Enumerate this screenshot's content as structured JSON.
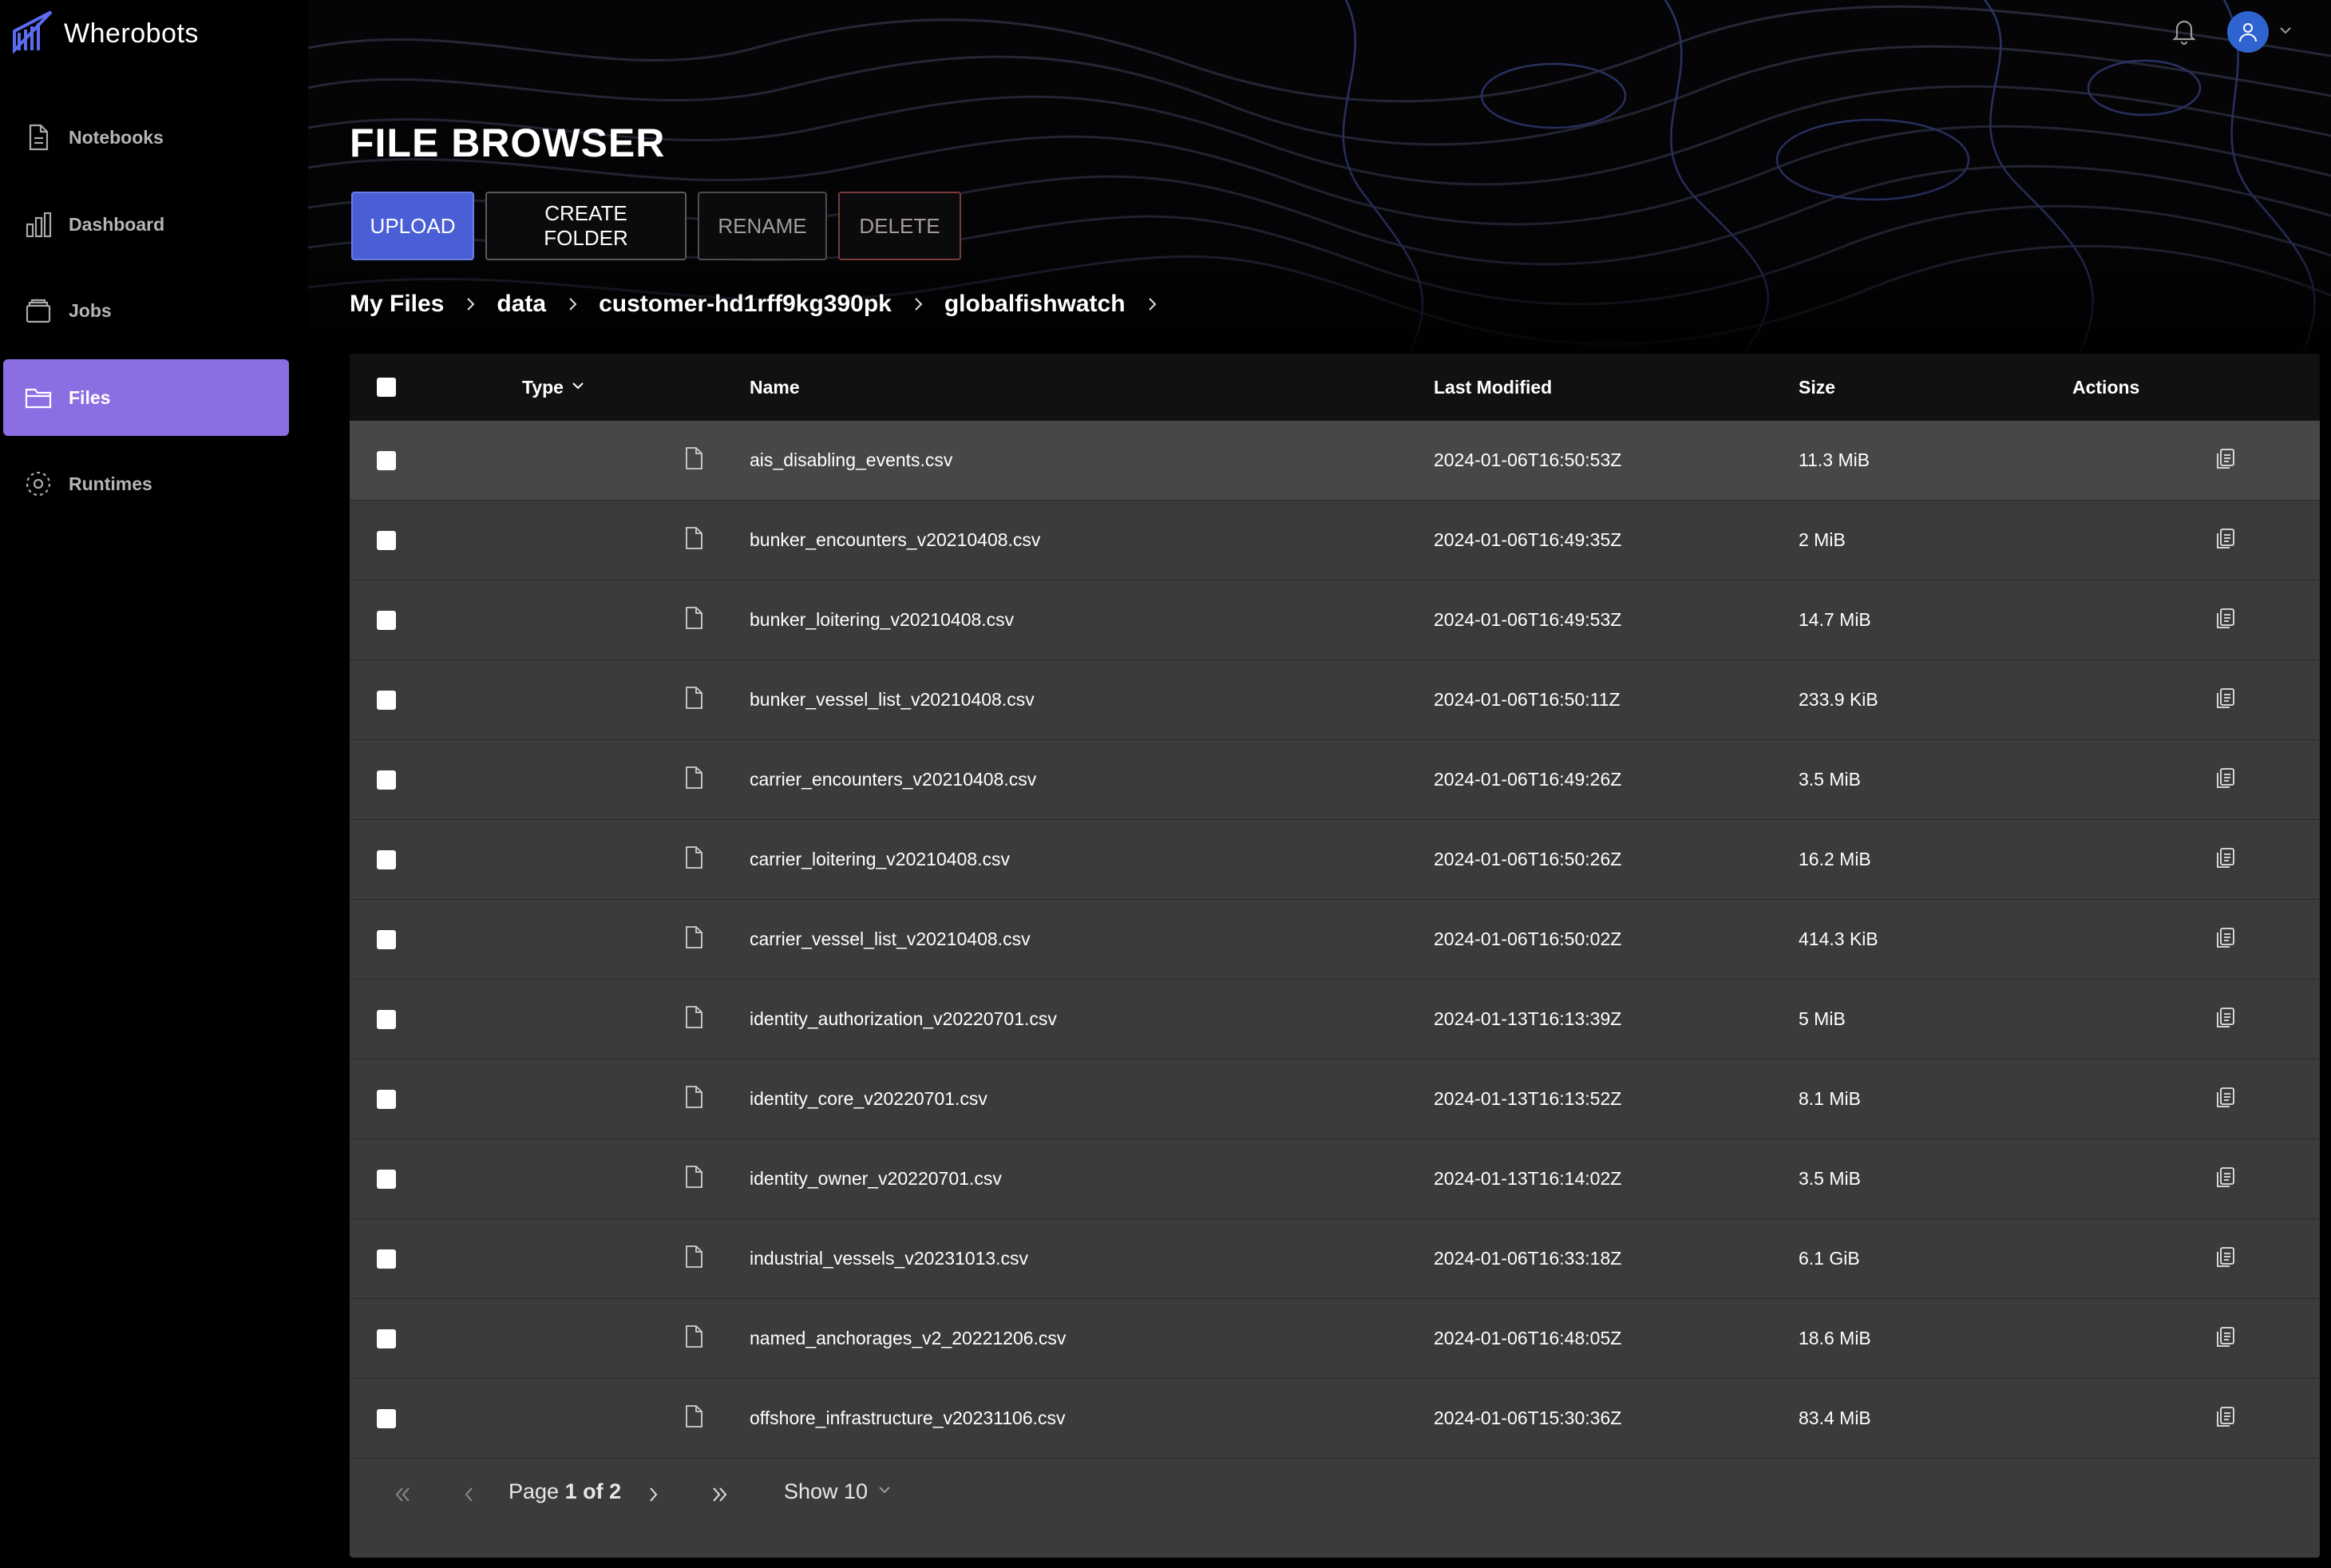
{
  "brand": {
    "name": "Wherobots"
  },
  "nav": [
    {
      "label": "Notebooks",
      "icon": "document-icon",
      "active": false
    },
    {
      "label": "Dashboard",
      "icon": "bar-chart-icon",
      "active": false
    },
    {
      "label": "Jobs",
      "icon": "jobs-box-icon",
      "active": false
    },
    {
      "label": "Files",
      "icon": "folder-icon",
      "active": true
    },
    {
      "label": "Runtimes",
      "icon": "runtimes-icon",
      "active": false
    }
  ],
  "header": {
    "title": "FILE BROWSER"
  },
  "toolbar": {
    "upload": "UPLOAD",
    "create_folder": "CREATE FOLDER",
    "rename": "RENAME",
    "delete": "DELETE"
  },
  "breadcrumb": [
    "My Files",
    "data",
    "customer-hd1rff9kg390pk",
    "globalfishwatch"
  ],
  "table": {
    "columns": {
      "type": "Type",
      "name": "Name",
      "modified": "Last Modified",
      "size": "Size",
      "actions": "Actions"
    },
    "rows": [
      {
        "name": "ais_disabling_events.csv",
        "modified": "2024-01-06T16:50:53Z",
        "size": "11.3 MiB"
      },
      {
        "name": "bunker_encounters_v20210408.csv",
        "modified": "2024-01-06T16:49:35Z",
        "size": "2 MiB"
      },
      {
        "name": "bunker_loitering_v20210408.csv",
        "modified": "2024-01-06T16:49:53Z",
        "size": "14.7 MiB"
      },
      {
        "name": "bunker_vessel_list_v20210408.csv",
        "modified": "2024-01-06T16:50:11Z",
        "size": "233.9 KiB"
      },
      {
        "name": "carrier_encounters_v20210408.csv",
        "modified": "2024-01-06T16:49:26Z",
        "size": "3.5 MiB"
      },
      {
        "name": "carrier_loitering_v20210408.csv",
        "modified": "2024-01-06T16:50:26Z",
        "size": "16.2 MiB"
      },
      {
        "name": "carrier_vessel_list_v20210408.csv",
        "modified": "2024-01-06T16:50:02Z",
        "size": "414.3 KiB"
      },
      {
        "name": "identity_authorization_v20220701.csv",
        "modified": "2024-01-13T16:13:39Z",
        "size": "5 MiB"
      },
      {
        "name": "identity_core_v20220701.csv",
        "modified": "2024-01-13T16:13:52Z",
        "size": "8.1 MiB"
      },
      {
        "name": "identity_owner_v20220701.csv",
        "modified": "2024-01-13T16:14:02Z",
        "size": "3.5 MiB"
      },
      {
        "name": "industrial_vessels_v20231013.csv",
        "modified": "2024-01-06T16:33:18Z",
        "size": "6.1 GiB"
      },
      {
        "name": "named_anchorages_v2_20221206.csv",
        "modified": "2024-01-06T16:48:05Z",
        "size": "18.6 MiB"
      },
      {
        "name": "offshore_infrastructure_v20231106.csv",
        "modified": "2024-01-06T15:30:36Z",
        "size": "83.4 MiB"
      }
    ]
  },
  "pagination": {
    "page_word": "Page",
    "page_current": "1",
    "of_word": "of",
    "page_total": "2",
    "show_label": "Show 10"
  },
  "colors": {
    "accent": "#8c6ee3",
    "upload": "#4a5fd6",
    "avatar": "#2f63cf",
    "delete_border": "#7c3a3a"
  }
}
